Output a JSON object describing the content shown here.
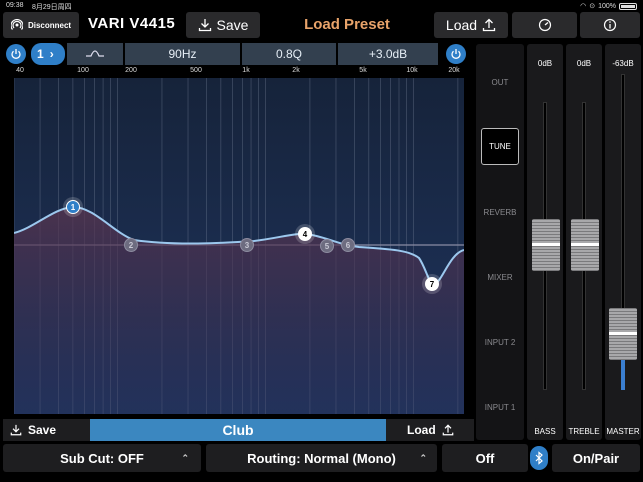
{
  "status_bar": {
    "time": "09:38",
    "date": "8月29日周四",
    "battery": "100%"
  },
  "header": {
    "disconnect_label": "Disconnect",
    "device_name": "VARI V4415",
    "save_label": "Save",
    "preset_title": "Load Preset",
    "load_label": "Load"
  },
  "eq": {
    "band": "1",
    "frequency": "90Hz",
    "q": "0.8Q",
    "gain": "+3.0dB",
    "freq_ticks": [
      "40",
      "100",
      "200",
      "500",
      "1k",
      "2k",
      "5k",
      "10k",
      "20k"
    ],
    "bands": [
      {
        "id": "1",
        "active": true
      },
      {
        "id": "2",
        "active": false
      },
      {
        "id": "3",
        "active": false
      },
      {
        "id": "4",
        "active": true
      },
      {
        "id": "5",
        "active": false
      },
      {
        "id": "6",
        "active": false
      },
      {
        "id": "7",
        "active": true
      }
    ]
  },
  "preset_bar": {
    "save_label": "Save",
    "preset_name": "Club",
    "load_label": "Load"
  },
  "menu": {
    "items": [
      "OUT",
      "TUNE",
      "REVERB",
      "MIXER",
      "INPUT 2",
      "INPUT 1"
    ],
    "active": "TUNE"
  },
  "faders": [
    {
      "name": "BASS",
      "value": "0dB"
    },
    {
      "name": "TREBLE",
      "value": "0dB"
    },
    {
      "name": "MASTER",
      "value": "-63dB"
    }
  ],
  "footer": {
    "sub_cut": "Sub Cut: OFF",
    "routing": "Routing: Normal (Mono)",
    "off_label": "Off",
    "pair_label": "On/Pair"
  },
  "colors": {
    "accent": "#2f7fc8",
    "preset_title": "#e8a36a",
    "graph_bg": "#1c2d4c"
  }
}
